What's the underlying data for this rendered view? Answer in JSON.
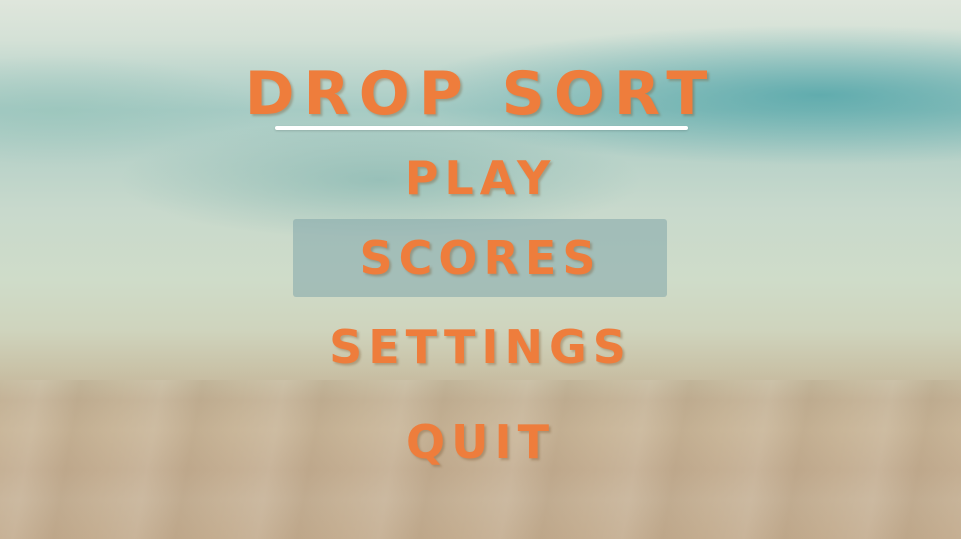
{
  "title": "DROP SORT",
  "menu": {
    "play_label": "PLAY",
    "scores_label": "SCORES",
    "settings_label": "SETTINGS",
    "quit_label": "QUIT",
    "selected": "SCORES"
  },
  "colors": {
    "text": "#ee7d3c",
    "underline": "#ffffff",
    "highlight": "#82a5aa"
  }
}
